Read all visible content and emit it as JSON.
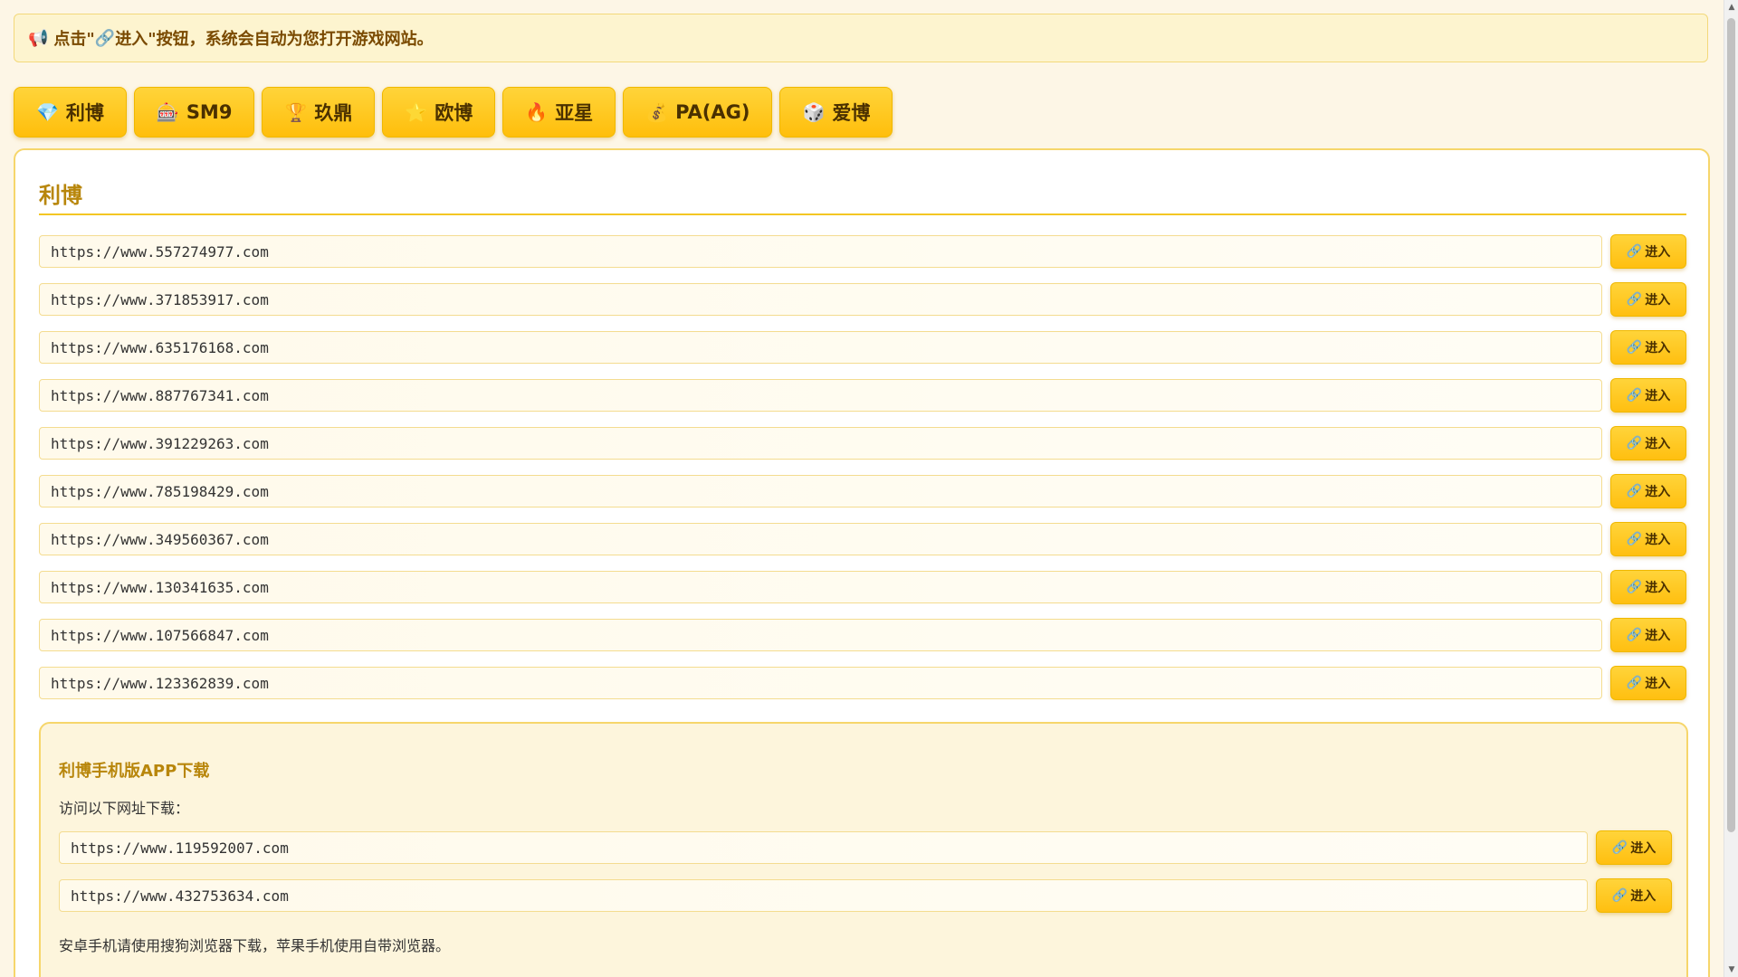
{
  "notice": {
    "icon": "megaphone-icon",
    "glyph": "📢",
    "text_before": "点击\"",
    "link_glyph": "🔗",
    "text_after": " 进入\"按钮，系统会自动为您打开游戏网站。"
  },
  "tabs": [
    {
      "glyph": "💎",
      "icon": "diamond-icon",
      "label": "利博"
    },
    {
      "glyph": "🎰",
      "icon": "slot-machine-icon",
      "label": "SM9"
    },
    {
      "glyph": "🏆",
      "icon": "trophy-icon",
      "label": "玖鼎"
    },
    {
      "glyph": "⭐",
      "icon": "star-icon",
      "label": "欧博"
    },
    {
      "glyph": "🔥",
      "icon": "fire-icon",
      "label": "亚星"
    },
    {
      "glyph": "💰",
      "icon": "money-bag-icon",
      "label": "PA(AG)"
    },
    {
      "glyph": "🎲",
      "icon": "dice-icon",
      "label": "爱博"
    }
  ],
  "panel": {
    "title": "利博",
    "enter_label": "进入",
    "enter_glyph": "🔗",
    "urls": [
      "https://www.557274977.com",
      "https://www.371853917.com",
      "https://www.635176168.com",
      "https://www.887767341.com",
      "https://www.391229263.com",
      "https://www.785198429.com",
      "https://www.349560367.com",
      "https://www.130341635.com",
      "https://www.107566847.com",
      "https://www.123362839.com"
    ]
  },
  "app": {
    "title": "利博手机版APP下载",
    "subtitle": "访问以下网址下载：",
    "urls": [
      "https://www.119592007.com",
      "https://www.432753634.com"
    ],
    "note": "安卓手机请使用搜狗浏览器下载，苹果手机使用自带浏览器。"
  },
  "colors": {
    "accent": "#ffc61a",
    "title": "#b8860b",
    "background": "#fdf6e6"
  }
}
